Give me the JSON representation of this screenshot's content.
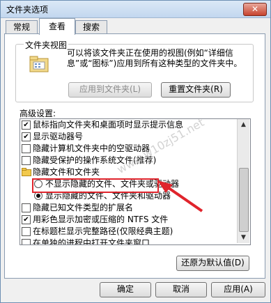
{
  "window": {
    "title": "文件夹选项",
    "close_glyph": "✕"
  },
  "tabs": [
    {
      "label": "常规"
    },
    {
      "label": "查看"
    },
    {
      "label": "搜索"
    }
  ],
  "folder_views": {
    "group_title": "文件夹视图",
    "description": "可以将该文件夹正在使用的视图(例如“详细信息”或“图标”)应用到所有这种类型的文件夹中。",
    "apply_button": "应用到文件夹(L)",
    "reset_button": "重置文件夹(R)"
  },
  "advanced": {
    "label": "高级设置:",
    "items": [
      {
        "type": "checkbox",
        "checked": true,
        "label": "鼠标指向文件夹和桌面项时显示提示信息"
      },
      {
        "type": "checkbox",
        "checked": true,
        "label": "显示驱动器号"
      },
      {
        "type": "checkbox",
        "checked": false,
        "label": "隐藏计算机文件夹中的空驱动器"
      },
      {
        "type": "checkbox",
        "checked": false,
        "label": "隐藏受保护的操作系统文件(推荐)"
      },
      {
        "type": "folder",
        "label": "隐藏文件和文件夹"
      },
      {
        "type": "radio",
        "checked": false,
        "label": "不显示隐藏的文件、文件夹或驱动器"
      },
      {
        "type": "radio",
        "checked": true,
        "label": "显示隐藏的文件、文件夹和驱动器"
      },
      {
        "type": "checkbox",
        "checked": false,
        "label": "隐藏已知文件类型的扩展名"
      },
      {
        "type": "checkbox",
        "checked": true,
        "label": "用彩色显示加密或压缩的 NTFS 文件"
      },
      {
        "type": "checkbox",
        "checked": false,
        "label": "在标题栏显示完整路径(仅限经典主题)"
      },
      {
        "type": "checkbox",
        "checked": false,
        "label": "在单独的进程中打开文件夹窗口"
      }
    ],
    "restore_button": "还原为默认值(D)"
  },
  "footer": {
    "ok": "确定",
    "cancel": "取消",
    "apply": "应用(A)"
  },
  "watermark": "www.w10zj51.net",
  "annotation_color": "#e0242c"
}
